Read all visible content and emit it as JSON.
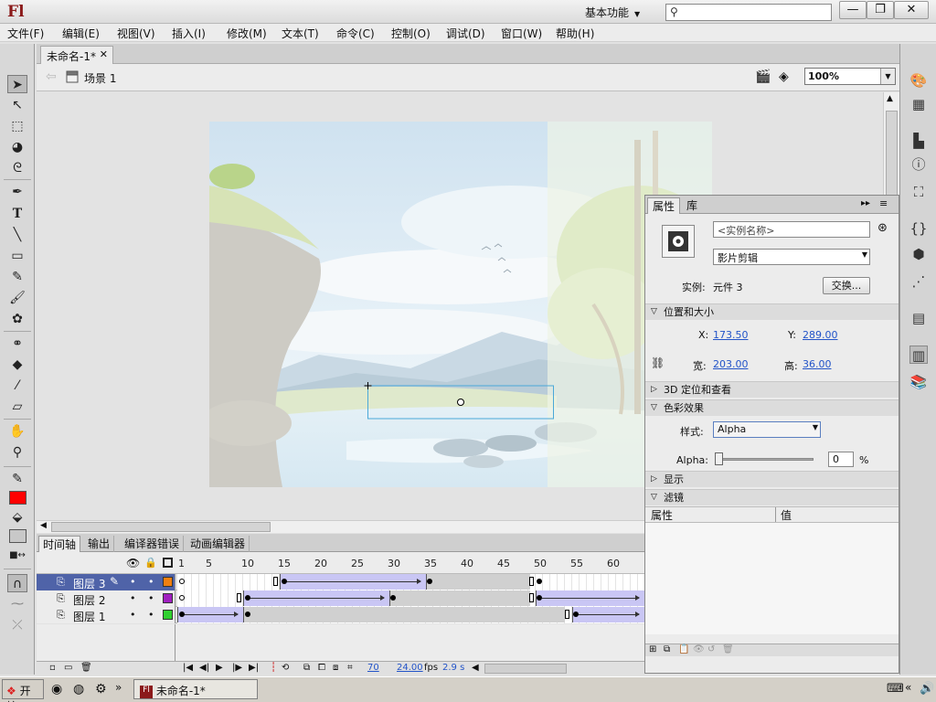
{
  "app": {
    "logo": "Fl",
    "workspace": "基本功能",
    "search_placeholder": ""
  },
  "window_controls": {
    "minimize": "—",
    "restore": "❐",
    "close": "✕"
  },
  "menu": [
    "文件(F)",
    "编辑(E)",
    "视图(V)",
    "插入(I)",
    "修改(M)",
    "文本(T)",
    "命令(C)",
    "控制(O)",
    "调试(D)",
    "窗口(W)",
    "帮助(H)"
  ],
  "document": {
    "tab_title": "未命名-1*",
    "scene": "场景 1",
    "zoom": "100%"
  },
  "timeline": {
    "tabs": [
      "时间轴",
      "输出",
      "编译器错误",
      "动画编辑器"
    ],
    "frame_numbers": [
      "1",
      "5",
      "10",
      "15",
      "20",
      "25",
      "30",
      "35",
      "40",
      "45",
      "50",
      "55",
      "60"
    ],
    "layers": [
      {
        "name": "图层 3",
        "color": "#f08010",
        "selected": true
      },
      {
        "name": "图层 2",
        "color": "#a020c0",
        "selected": false
      },
      {
        "name": "图层 1",
        "color": "#30d030",
        "selected": false
      }
    ],
    "footer": {
      "current_frame": "70",
      "fps": "24.00",
      "fps_unit": "fps",
      "time": "2.9 s"
    }
  },
  "properties": {
    "tabs": [
      "属性",
      "库"
    ],
    "instance_name_placeholder": "<实例名称>",
    "symbol_type": "影片剪辑",
    "instance_label": "实例:",
    "instance_of": "元件 3",
    "swap_button": "交换...",
    "section_position": "位置和大小",
    "x_label": "X:",
    "x_value": "173.50",
    "y_label": "Y:",
    "y_value": "289.00",
    "w_label": "宽:",
    "w_value": "203.00",
    "h_label": "高:",
    "h_value": "36.00",
    "section_3d": "3D 定位和查看",
    "section_color": "色彩效果",
    "style_label": "样式:",
    "style_value": "Alpha",
    "alpha_label": "Alpha:",
    "alpha_value": "0",
    "alpha_unit": "%",
    "section_display": "显示",
    "section_filters": "滤镜",
    "filter_col_property": "属性",
    "filter_col_value": "值"
  },
  "taskbar": {
    "start": "开始",
    "task_item": "未命名-1*"
  }
}
